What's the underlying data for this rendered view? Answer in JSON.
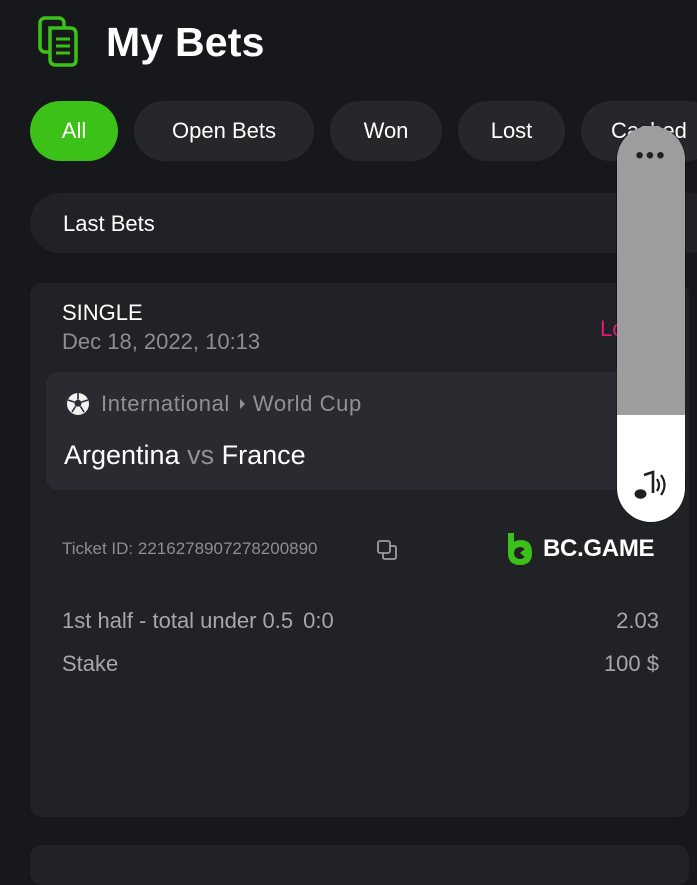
{
  "header": {
    "title": "My Bets",
    "icon": "bets-document-icon"
  },
  "filters": [
    {
      "label": "All",
      "active": true
    },
    {
      "label": "Open Bets",
      "active": false
    },
    {
      "label": "Won",
      "active": false
    },
    {
      "label": "Lost",
      "active": false
    },
    {
      "label": "Cashed",
      "active": false
    }
  ],
  "last_bets": {
    "label": "Last Bets",
    "chevron": "›"
  },
  "bet": {
    "type": "SINGLE",
    "date": "Dec 18, 2022, 10:13",
    "status": "Lo",
    "league": {
      "region": "International",
      "competition": "World Cup"
    },
    "teams": {
      "home": "Argentina",
      "vs": "vs",
      "away": "France"
    },
    "ticket_id": "Ticket ID: 2216278907278200890",
    "brand": "BC.GAME",
    "market": {
      "name": "1st half - total under 0.5",
      "score": "0:0",
      "odds": "2.03"
    },
    "stake": {
      "label": "Stake",
      "value": "100 $"
    }
  },
  "volume_overlay": {
    "more": "•••",
    "level": 0.27
  },
  "colors": {
    "accent": "#3bc117",
    "background": "#17181b",
    "card": "#212226",
    "lost": "#e2197a"
  }
}
